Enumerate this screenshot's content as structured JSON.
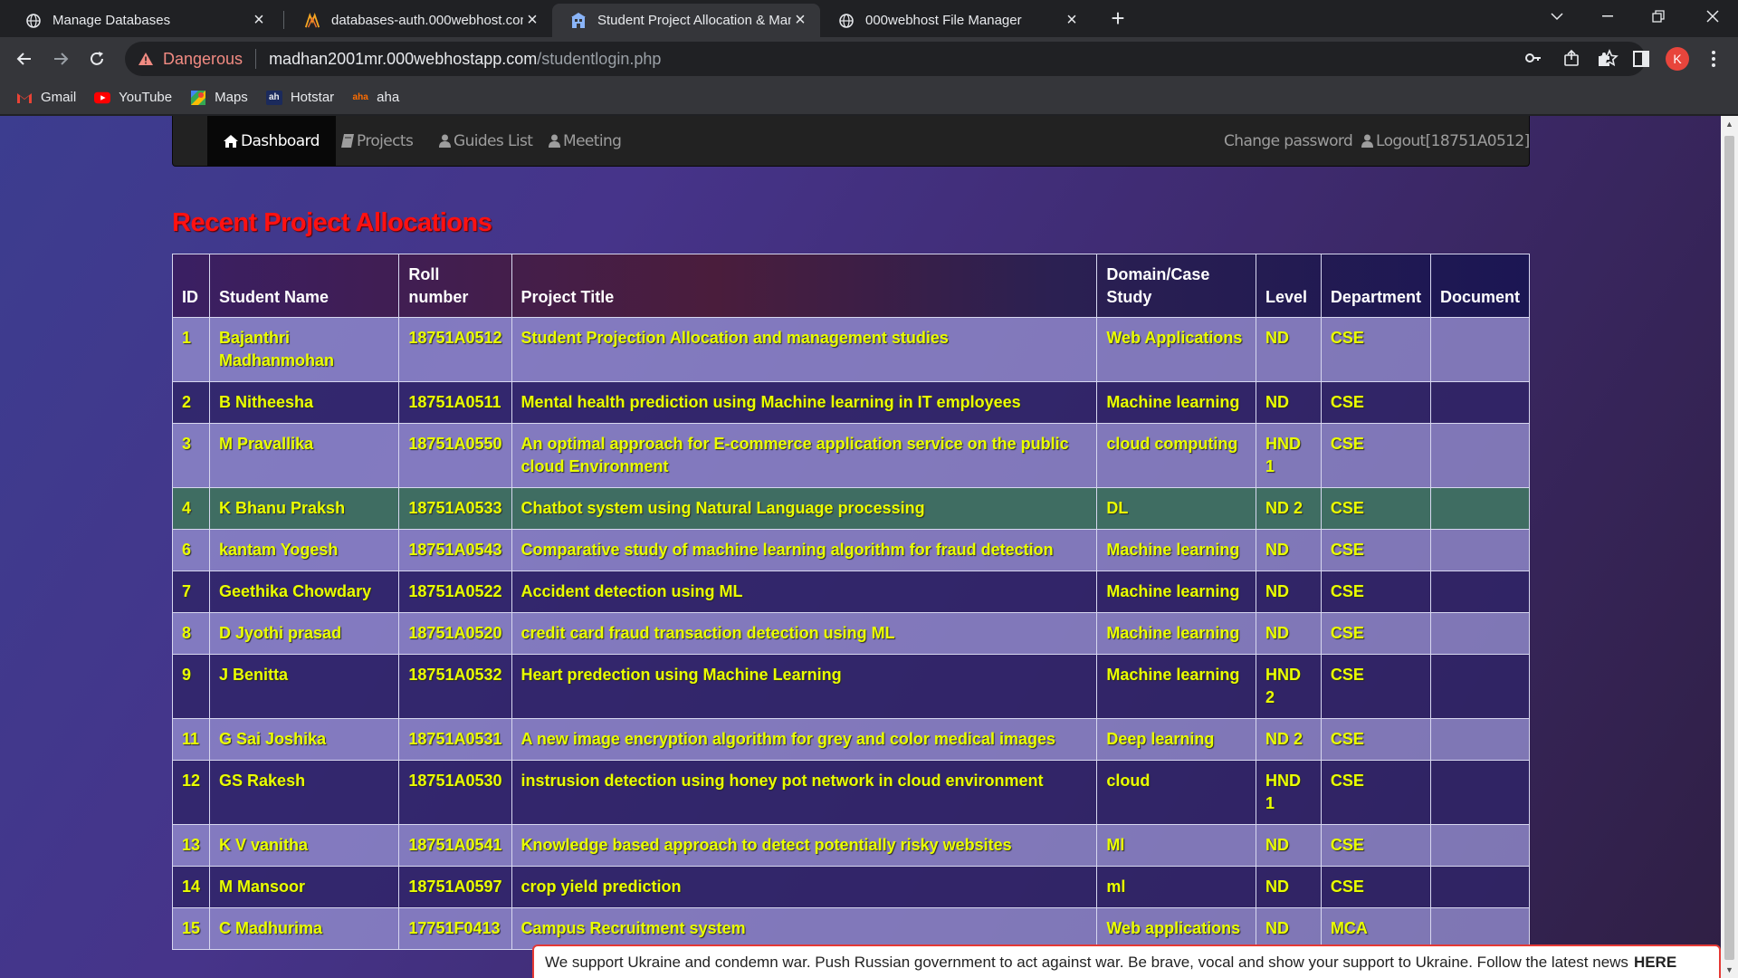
{
  "browser": {
    "tabs": [
      {
        "title": "Manage Databases",
        "icon": "globe-icon",
        "active": false
      },
      {
        "title": "databases-auth.000webhost.com",
        "icon": "000webhost-logo-icon",
        "active": false
      },
      {
        "title": "Student Project Allocation & Man",
        "icon": "building-icon",
        "active": true
      },
      {
        "title": "000webhost File Manager",
        "icon": "globe-icon",
        "active": false
      }
    ],
    "security_label": "Dangerous",
    "url_host": "madhan2001mr.000webhostapp.com",
    "url_path": "/studentlogin.php",
    "profile_initial": "K",
    "bookmarks": [
      {
        "label": "Gmail",
        "icon": "gmail-icon"
      },
      {
        "label": "YouTube",
        "icon": "youtube-icon"
      },
      {
        "label": "Maps",
        "icon": "maps-icon"
      },
      {
        "label": "Hotstar",
        "icon": "hotstar-icon",
        "badge": "ah"
      },
      {
        "label": "aha",
        "icon": "aha-icon",
        "badge": "aha"
      }
    ]
  },
  "nav": {
    "dashboard": "Dashboard",
    "projects": "Projects",
    "guides": "Guides List",
    "meeting": "Meeting",
    "change_password": "Change password",
    "logout": "Logout[18751A0512]"
  },
  "page": {
    "heading": "Recent Project Allocations"
  },
  "table": {
    "headers": {
      "id": "ID",
      "student_name": "Student Name",
      "roll": "Roll number",
      "title": "Project Title",
      "domain": "Domain/Case Study",
      "level": "Level",
      "department": "Department",
      "document": "Document"
    },
    "rows": [
      {
        "id": "1",
        "name": "Bajanthri Madhanmohan",
        "roll": "18751A0512",
        "title": "Student Projection Allocation and management studies",
        "domain": "Web Applications",
        "level": "ND",
        "dept": "CSE",
        "doc": ""
      },
      {
        "id": "2",
        "name": "B Nitheesha",
        "roll": "18751A0511",
        "title": "Mental health prediction using Machine learning in IT employees",
        "domain": "Machine learning",
        "level": "ND",
        "dept": "CSE",
        "doc": ""
      },
      {
        "id": "3",
        "name": "M Pravallika",
        "roll": "18751A0550",
        "title": "An optimal approach for E-commerce application service on the public cloud Environment",
        "domain": "cloud computing",
        "level": "HND 1",
        "dept": "CSE",
        "doc": ""
      },
      {
        "id": "4",
        "name": "K Bhanu Praksh",
        "roll": "18751A0533",
        "title": "Chatbot system using Natural Language processing",
        "domain": "DL",
        "level": "ND 2",
        "dept": "CSE",
        "doc": ""
      },
      {
        "id": "6",
        "name": "kantam Yogesh",
        "roll": "18751A0543",
        "title": "Comparative study of machine learning algorithm for fraud detection",
        "domain": "Machine learning",
        "level": "ND",
        "dept": "CSE",
        "doc": ""
      },
      {
        "id": "7",
        "name": "Geethika Chowdary",
        "roll": "18751A0522",
        "title": "Accident detection using ML",
        "domain": "Machine learning",
        "level": "ND",
        "dept": "CSE",
        "doc": ""
      },
      {
        "id": "8",
        "name": "D Jyothi prasad",
        "roll": "18751A0520",
        "title": "credit card fraud transaction detection using ML",
        "domain": "Machine learning",
        "level": "ND",
        "dept": "CSE",
        "doc": ""
      },
      {
        "id": "9",
        "name": "J Benitta",
        "roll": "18751A0532",
        "title": "Heart predection using Machine Learning",
        "domain": "Machine learning",
        "level": "HND 2",
        "dept": "CSE",
        "doc": ""
      },
      {
        "id": "11",
        "name": "G Sai Joshika",
        "roll": "18751A0531",
        "title": "A new image encryption algorithm for grey and color medical images",
        "domain": "Deep learning",
        "level": "ND 2",
        "dept": "CSE",
        "doc": ""
      },
      {
        "id": "12",
        "name": "GS Rakesh",
        "roll": "18751A0530",
        "title": "instrusion detection using honey pot network in cloud environment",
        "domain": "cloud",
        "level": "HND 1",
        "dept": "CSE",
        "doc": ""
      },
      {
        "id": "13",
        "name": "K V vanitha",
        "roll": "18751A0541",
        "title": "Knowledge based approach to detect potentially risky websites",
        "domain": "Ml",
        "level": "ND",
        "dept": "CSE",
        "doc": ""
      },
      {
        "id": "14",
        "name": "M Mansoor",
        "roll": "18751A0597",
        "title": "crop yield prediction",
        "domain": "ml",
        "level": "ND",
        "dept": "CSE",
        "doc": ""
      },
      {
        "id": "15",
        "name": "C Madhurima",
        "roll": "17751F0413",
        "title": "Campus Recruitment system",
        "domain": "Web applications",
        "level": "ND",
        "dept": "MCA",
        "doc": ""
      }
    ]
  },
  "banner": {
    "text": "We support Ukraine and condemn war. Push Russian government to act against war. Be brave, vocal and show your support to Ukraine. Follow the latest news",
    "link": "HERE"
  }
}
